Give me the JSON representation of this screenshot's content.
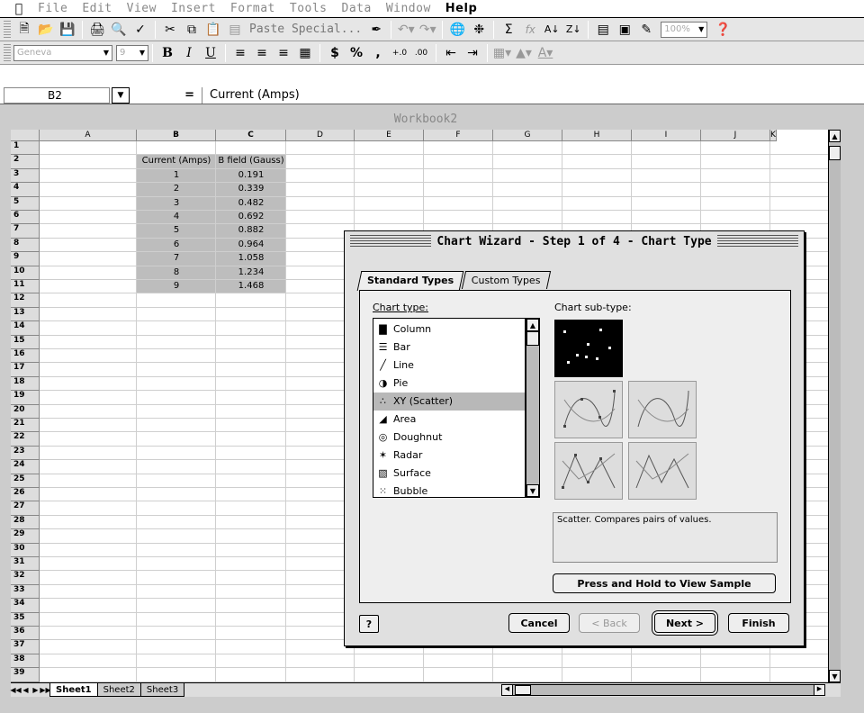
{
  "menubar": {
    "items": [
      "File",
      "Edit",
      "View",
      "Insert",
      "Format",
      "Tools",
      "Data",
      "Window",
      "Help"
    ],
    "active": "Help"
  },
  "toolbar": {
    "paste_special": "Paste Special...",
    "zoom": "100%"
  },
  "format_toolbar": {
    "font": "Geneva",
    "size": "9"
  },
  "formula_bar": {
    "cell_ref": "B2",
    "equals": "=",
    "content": "Current (Amps)"
  },
  "workbook": {
    "title": "Workbook2",
    "columns": [
      "A",
      "B",
      "C",
      "D",
      "E",
      "F",
      "G",
      "H",
      "I",
      "J",
      "K"
    ],
    "rows": [
      "1",
      "2",
      "3",
      "4",
      "5",
      "6",
      "7",
      "8",
      "9",
      "10",
      "11",
      "12",
      "13",
      "14",
      "15",
      "16",
      "17",
      "18",
      "19",
      "20",
      "21",
      "22",
      "23",
      "24",
      "25",
      "26",
      "27",
      "28",
      "29",
      "30",
      "31",
      "32",
      "33",
      "34",
      "35",
      "36",
      "37",
      "38",
      "39"
    ],
    "headers": [
      "Current (Amps)",
      "B field (Gauss)"
    ],
    "data": [
      [
        "1",
        "0.191"
      ],
      [
        "2",
        "0.339"
      ],
      [
        "3",
        "0.482"
      ],
      [
        "4",
        "0.692"
      ],
      [
        "5",
        "0.882"
      ],
      [
        "6",
        "0.964"
      ],
      [
        "7",
        "1.058"
      ],
      [
        "8",
        "1.234"
      ],
      [
        "9",
        "1.468"
      ]
    ],
    "sheets": [
      "Sheet1",
      "Sheet2",
      "Sheet3"
    ],
    "active_sheet": "Sheet1"
  },
  "dialog": {
    "title": "Chart Wizard - Step 1 of 4 - Chart Type",
    "tabs": [
      "Standard Types",
      "Custom Types"
    ],
    "chart_type_label": "Chart type:",
    "sub_type_label": "Chart sub-type:",
    "types": [
      {
        "label": "Column",
        "icon": "column-chart-icon"
      },
      {
        "label": "Bar",
        "icon": "bar-chart-icon"
      },
      {
        "label": "Line",
        "icon": "line-chart-icon"
      },
      {
        "label": "Pie",
        "icon": "pie-chart-icon"
      },
      {
        "label": "XY (Scatter)",
        "icon": "scatter-chart-icon"
      },
      {
        "label": "Area",
        "icon": "area-chart-icon"
      },
      {
        "label": "Doughnut",
        "icon": "doughnut-chart-icon"
      },
      {
        "label": "Radar",
        "icon": "radar-chart-icon"
      },
      {
        "label": "Surface",
        "icon": "surface-chart-icon"
      },
      {
        "label": "Bubble",
        "icon": "bubble-chart-icon"
      }
    ],
    "selected_type": "XY (Scatter)",
    "description": "Scatter. Compares pairs of values.",
    "sample_button": "Press and Hold to View Sample",
    "help_button": "?",
    "cancel": "Cancel",
    "back": "< Back",
    "next": "Next >",
    "finish": "Finish"
  }
}
